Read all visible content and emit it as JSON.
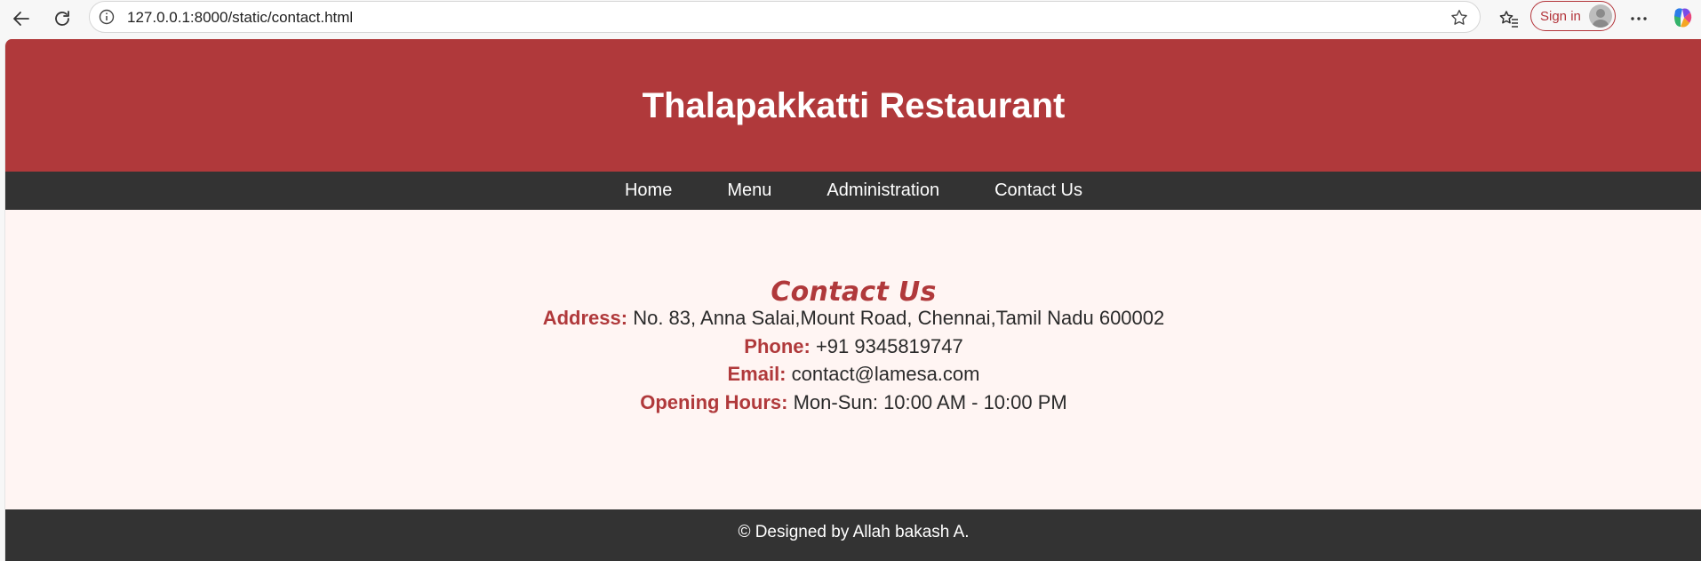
{
  "browser": {
    "url": "127.0.0.1:8000/static/contact.html",
    "signin_label": "Sign in",
    "icons": [
      "back-arrow-icon",
      "reload-icon",
      "info-icon",
      "star-icon",
      "favorites-icon",
      "more-icon",
      "copilot-icon"
    ]
  },
  "site": {
    "title": "Thalapakkatti Restaurant",
    "nav": [
      {
        "label": "Home"
      },
      {
        "label": "Menu"
      },
      {
        "label": "Administration"
      },
      {
        "label": "Contact Us"
      }
    ]
  },
  "contact": {
    "heading": "Contact Us",
    "address_label": "Address:",
    "address_value": " No. 83, Anna Salai,Mount Road, Chennai,Tamil Nadu 600002",
    "phone_label": "Phone:",
    "phone_value": " +91 9345819747",
    "email_label": "Email:",
    "email_value": " contact@lamesa.com",
    "hours_label": "Opening Hours:",
    "hours_value": " Mon-Sun: 10:00 AM - 10:00 PM"
  },
  "footer": {
    "text": "© Designed by Allah bakash A."
  },
  "colors": {
    "brand_red": "#b0393b",
    "nav_dark": "#333333",
    "page_bg": "#fff5f3"
  }
}
